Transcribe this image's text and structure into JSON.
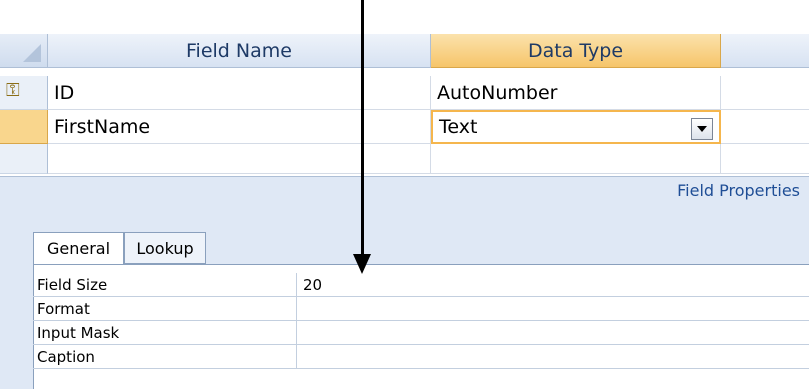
{
  "grid": {
    "headers": {
      "field_name": "Field Name",
      "data_type": "Data Type"
    },
    "rows": [
      {
        "field_name": "ID",
        "data_type": "AutoNumber",
        "primary_key": true
      },
      {
        "field_name": "FirstName",
        "data_type": "Text",
        "selected": true
      },
      {
        "field_name": "",
        "data_type": ""
      }
    ]
  },
  "field_properties": {
    "title": "Field Properties",
    "tabs": [
      "General",
      "Lookup"
    ],
    "active_tab": "General",
    "properties": [
      {
        "label": "Field Size",
        "value": "20"
      },
      {
        "label": "Format",
        "value": ""
      },
      {
        "label": "Input Mask",
        "value": ""
      },
      {
        "label": "Caption",
        "value": ""
      }
    ]
  },
  "icons": {
    "primary_key": "key-icon",
    "dropdown": "chevron-down-icon"
  },
  "colors": {
    "accent": "#f6c56a",
    "header_blue": "#d7e2f2",
    "panel": "#dfe8f5"
  }
}
